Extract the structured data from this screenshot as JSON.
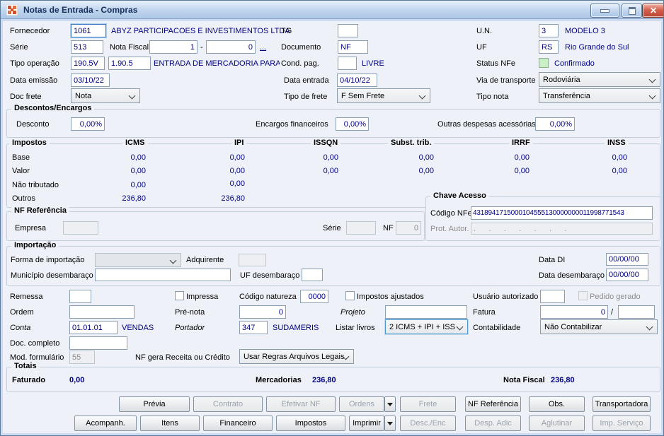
{
  "window": {
    "title": "Notas de Entrada - Compras"
  },
  "header": {
    "fornecedor_label": "Fornecedor",
    "fornecedor_value": "1061",
    "fornecedor_name": "ABYZ PARTICIPACOES E INVESTIMENTOS LTDA",
    "tg_label": "TG",
    "tg_value": "",
    "un_label": "U.N.",
    "un_value": "3",
    "un_desc": "MODELO 3",
    "serie_label": "Série",
    "serie_value": "513",
    "nota_fiscal_label": "Nota Fiscal",
    "nota_fiscal_value": "1",
    "nota_fiscal_sep": "-",
    "nota_fiscal_value2": "0",
    "more_link": "...",
    "documento_label": "Documento",
    "documento_value": "NF",
    "uf_label": "UF",
    "uf_value": "RS",
    "uf_desc": "Rio Grande do Sul",
    "tipo_operacao_label": "Tipo operação",
    "tipo_operacao_value": "190.5V",
    "tipo_operacao_value2": "1.90.5",
    "tipo_operacao_desc": "ENTRADA DE MERCADORIA PARA DE",
    "cond_pag_label": "Cond. pag.",
    "cond_pag_value": "",
    "cond_pag_desc": "LIVRE",
    "status_nfe_label": "Status NFe",
    "status_nfe_value": "Confirmado",
    "data_emissao_label": "Data emissão",
    "data_emissao_value": "03/10/22",
    "data_entrada_label": "Data entrada",
    "data_entrada_value": "04/10/22",
    "via_transporte_label": "Via de transporte",
    "via_transporte_value": "Rodoviária",
    "doc_frete_label": "Doc frete",
    "doc_frete_value": "Nota",
    "tipo_frete_label": "Tipo de frete",
    "tipo_frete_value": "F Sem Frete",
    "tipo_nota_label": "Tipo nota",
    "tipo_nota_value": "Transferência"
  },
  "descontos": {
    "title": "Descontos/Encargos",
    "desconto_label": "Desconto",
    "desconto_value": "0,00%",
    "encargos_label": "Encargos financeiros",
    "encargos_value": "0,00%",
    "outras_label": "Outras despesas acessórias",
    "outras_value": "0,00%"
  },
  "impostos": {
    "title": "Impostos",
    "columns": [
      "ICMS",
      "IPI",
      "ISSQN",
      "Subst. trib.",
      "IRRF",
      "INSS"
    ],
    "rows": [
      {
        "label": "Base",
        "values": [
          "0,00",
          "0,00",
          "0,00",
          "0,00",
          "0,00",
          "0,00"
        ]
      },
      {
        "label": "Valor",
        "values": [
          "0,00",
          "0,00",
          "0,00",
          "0,00",
          "0,00",
          "0,00"
        ]
      },
      {
        "label": "Não tributado",
        "values": [
          "0,00",
          "0,00",
          "",
          "",
          "",
          ""
        ]
      },
      {
        "label": "Outros",
        "values": [
          "236,80",
          "236,80",
          "",
          "",
          "",
          ""
        ]
      }
    ]
  },
  "chave_acesso": {
    "title": "Chave Acesso",
    "codigo_label": "Código NFe",
    "codigo_value": "4318941715000104555130000000011998771543",
    "prot_label": "Prot. Autor.",
    "prot_value": ".      .      .      .      .      .      ."
  },
  "nf_referencia": {
    "title": "NF Referência",
    "empresa_label": "Empresa",
    "empresa_value": "",
    "serie_label": "Série",
    "serie_value": "",
    "nf_label": "NF",
    "nf_value": "0"
  },
  "importacao": {
    "title": "Importação",
    "forma_label": "Forma de importação",
    "forma_value": "",
    "adquirente_label": "Adquirente",
    "adquirente_value": "",
    "data_di_label": "Data DI",
    "data_di_value": "00/00/00",
    "municipio_label": "Município desembaraço",
    "municipio_value": "",
    "uf_label": "UF desembaraço",
    "uf_value": "",
    "data_desembaraco_label": "Data desembaraço",
    "data_desembaraco_value": "00/00/00"
  },
  "detalhes": {
    "remessa_label": "Remessa",
    "remessa_value": "",
    "impressa_label": "Impressa",
    "codigo_natureza_label": "Código natureza",
    "codigo_natureza_value": "0000",
    "impostos_ajustados_label": "Impostos ajustados",
    "usuario_autorizado_label": "Usuário autorizado",
    "usuario_autorizado_value": "",
    "pedido_gerado_label": "Pedido gerado",
    "ordem_label": "Ordem",
    "ordem_value": "",
    "pre_nota_label": "Pré-nota",
    "pre_nota_value": "0",
    "projeto_label": "Projeto",
    "projeto_value": "",
    "fatura_label": "Fatura",
    "fatura_value": "0",
    "fatura_sep": "/",
    "fatura_value2": "",
    "conta_label": "Conta",
    "conta_value": "01.01.01",
    "conta_desc": "VENDAS",
    "portador_label": "Portador",
    "portador_value": "347",
    "portador_desc": "SUDAMERIS",
    "listar_livros_label": "Listar livros",
    "listar_livros_value": "2 ICMS + IPI + ISS",
    "contabilidade_label": "Contabilidade",
    "contabilidade_value": "Não Contabilizar",
    "doc_completo_label": "Doc. completo",
    "doc_completo_value": "",
    "mod_formulario_label": "Mod. formulário",
    "mod_formulario_value": "55",
    "nf_gera_label": "NF gera Receita ou Crédito",
    "nf_gera_value": "Usar Regras Arquivos Legais"
  },
  "totais": {
    "title": "Totais",
    "faturado_label": "Faturado",
    "faturado_value": "0,00",
    "mercadorias_label": "Mercadorias",
    "mercadorias_value": "236,80",
    "nota_fiscal_label": "Nota Fiscal",
    "nota_fiscal_value": "236,80"
  },
  "buttons": {
    "previa": "Prévia",
    "contrato": "Contrato",
    "efetivar_nf": "Efetivar NF",
    "ordens": "Ordens",
    "frete": "Frete",
    "nf_referencia": "NF Referência",
    "obs": "Obs.",
    "transportadora": "Transportadora",
    "acompanh": "Acompanh.",
    "itens": "Itens",
    "financeiro": "Financeiro",
    "impostos": "Impostos",
    "imprimir": "Imprimir",
    "desc_enc": "Desc./Enc",
    "desp_adic": "Desp. Adic",
    "aglutinar": "Aglutinar",
    "imp_servico": "Imp. Serviço"
  },
  "colors": {
    "accent_navy": "#000080",
    "status_ok_green": "#c9f0c4",
    "close_red": "#c9523f"
  }
}
